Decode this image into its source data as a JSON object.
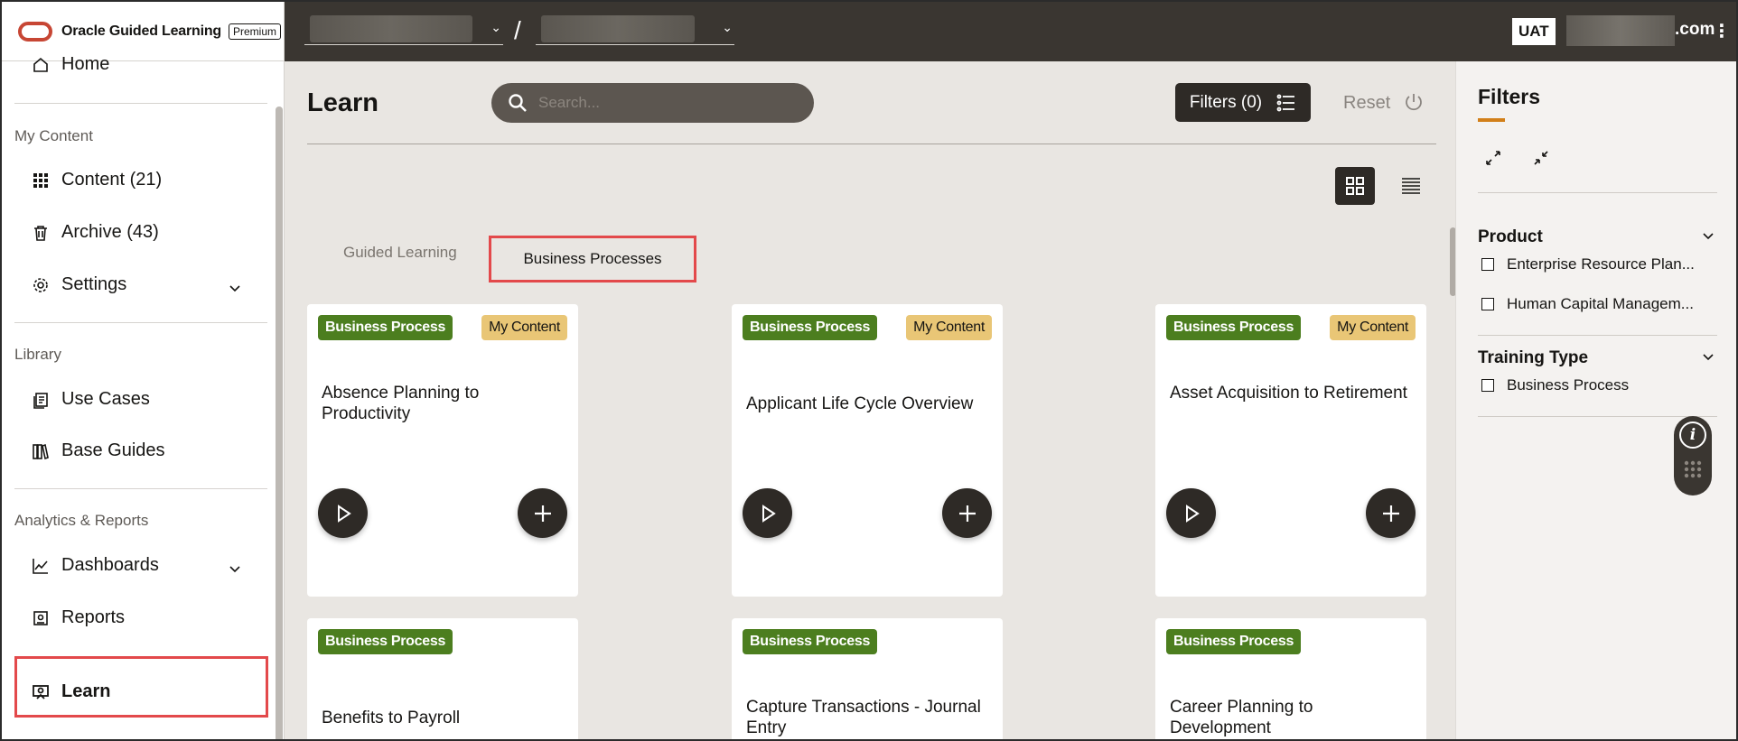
{
  "brand": {
    "name": "Oracle Guided Learning",
    "badge": "Premium"
  },
  "sidebar": {
    "home": "Home",
    "sections": {
      "my_content": "My Content",
      "library": "Library",
      "analytics": "Analytics & Reports"
    },
    "items": {
      "content": "Content (21)",
      "archive": "Archive (43)",
      "settings": "Settings",
      "use_cases": "Use Cases",
      "base_guides": "Base Guides",
      "dashboards": "Dashboards",
      "reports": "Reports",
      "learn": "Learn"
    }
  },
  "topbar": {
    "env": "UAT",
    "account_domain": ".com",
    "separator": "/",
    "menu": "⋮"
  },
  "main": {
    "title": "Learn",
    "search_placeholder": "Search...",
    "filters_label": "Filters (0)",
    "reset_label": "Reset",
    "tabs": {
      "guided_learning": "Guided Learning",
      "business_processes": "Business Processes"
    }
  },
  "cards": [
    {
      "badge": "Business Process",
      "tag": "My Content",
      "title": "Absence Planning to Productivity"
    },
    {
      "badge": "Business Process",
      "tag": "My Content",
      "title": "Applicant Life Cycle Overview"
    },
    {
      "badge": "Business Process",
      "tag": "My Content",
      "title": "Asset Acquisition to Retirement"
    },
    {
      "badge": "Business Process",
      "tag": "",
      "title": "Benefits to Payroll"
    },
    {
      "badge": "Business Process",
      "tag": "",
      "title": "Capture Transactions - Journal Entry"
    },
    {
      "badge": "Business Process",
      "tag": "",
      "title": "Career Planning to Development"
    }
  ],
  "filters_panel": {
    "title": "Filters",
    "groups": {
      "product": {
        "title": "Product",
        "options": [
          "Enterprise Resource Plan...",
          "Human Capital Managem..."
        ]
      },
      "training_type": {
        "title": "Training Type",
        "options": [
          "Business Process"
        ]
      }
    },
    "help_glyph": "i"
  },
  "colors": {
    "accent": "#d27f19",
    "badge_green": "#4c7e1f",
    "badge_yellow": "#e9c676",
    "highlight_red": "#e3494b",
    "topbar": "#3a3631"
  }
}
